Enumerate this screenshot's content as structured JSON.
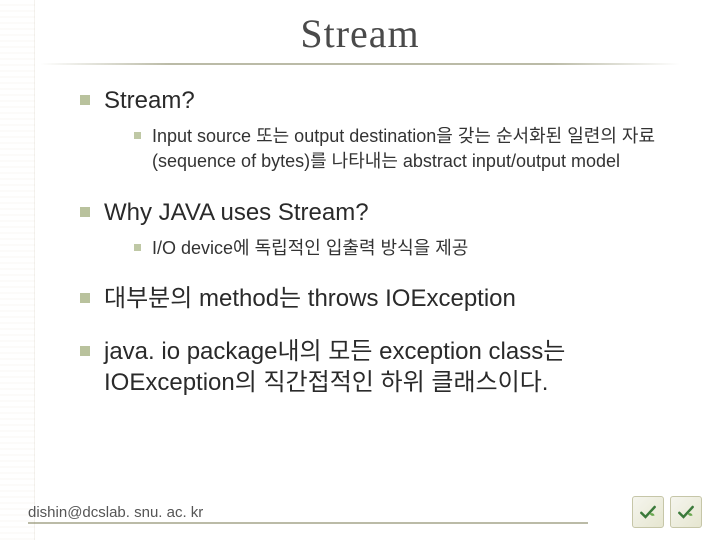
{
  "title": "Stream",
  "bullets": [
    {
      "text": "Stream?",
      "children": [
        {
          "text": "Input source 또는 output destination을 갖는 순서화된 일련의 자료(sequence of bytes)를 나타내는 abstract input/output model"
        }
      ]
    },
    {
      "text": "Why JAVA uses Stream?",
      "children": [
        {
          "text": "I/O device에 독립적인 입출력 방식을 제공"
        }
      ]
    },
    {
      "text": "대부분의 method는 throws IOException",
      "children": []
    },
    {
      "text": "java. io package내의 모든 exception class는 IOException의 직간접적인 하위 클래스이다.",
      "children": []
    }
  ],
  "footer": "dishin@dcslab. snu. ac. kr",
  "logos": {
    "left_icon": "check-leaf-icon",
    "right_icon": "check-leaf-icon"
  }
}
